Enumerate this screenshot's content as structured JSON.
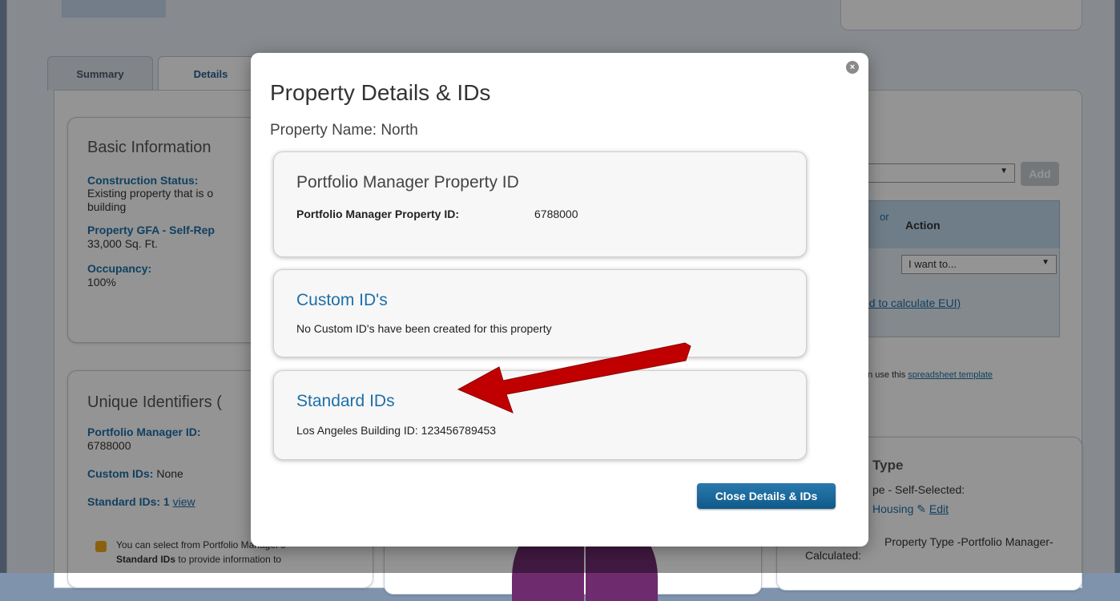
{
  "tabs": [
    {
      "label": "Summary"
    },
    {
      "label": "Details"
    }
  ],
  "basic_info": {
    "title": "Basic Information",
    "construction_label": "Construction Status:",
    "construction_value_1": "Existing property that is o",
    "construction_value_2": "building",
    "gfa_label": "Property GFA - Self-Rep",
    "gfa_value": "33,000 Sq. Ft.",
    "occupancy_label": "Occupancy:",
    "occupancy_value": "100%"
  },
  "unique_ids": {
    "title": "Unique Identifiers (",
    "pm_id_label": "Portfolio Manager ID:",
    "pm_id_value": "6788000",
    "custom_label": "Custom IDs:",
    "custom_value": "None",
    "standard_label": "Standard IDs:",
    "standard_value": "1",
    "standard_link": "view",
    "info_1": "You can select from Portfolio Manager's",
    "info_2_bold": "Standard IDs",
    "info_2_rest": "to provide information to"
  },
  "right_panel": {
    "add_label": "Add",
    "col_partial": "or",
    "col_action": "Action",
    "select_value": "I want to...",
    "eui_link": "ed to calculate EUI)",
    "spreadsheet_prefix": "an use this",
    "spreadsheet_link": "spreadsheet template",
    "type_title": "Type",
    "type_self": "pe - Self-Selected:",
    "type_housing": "Housing",
    "edit_link": "Edit",
    "type_pm_1": "Property Type -Portfolio Manager-",
    "type_pm_2": "Calculated:"
  },
  "modal": {
    "title": "Property Details & IDs",
    "subtitle": "Property Name: North",
    "pm_card_title": "Portfolio Manager Property ID",
    "pm_card_label": "Portfolio Manager Property ID:",
    "pm_card_value": "6788000",
    "custom_card_title": "Custom ID's",
    "custom_card_text": "No Custom ID's have been created for this property",
    "standard_card_title": "Standard IDs",
    "standard_card_text": "Los Angeles Building ID: 123456789453",
    "close_button": "Close Details & IDs",
    "close_icon": "×"
  },
  "colors": {
    "link_blue": "#1d6fa8",
    "arrow_red": "#c00000",
    "button_blue": "#1466a0"
  }
}
